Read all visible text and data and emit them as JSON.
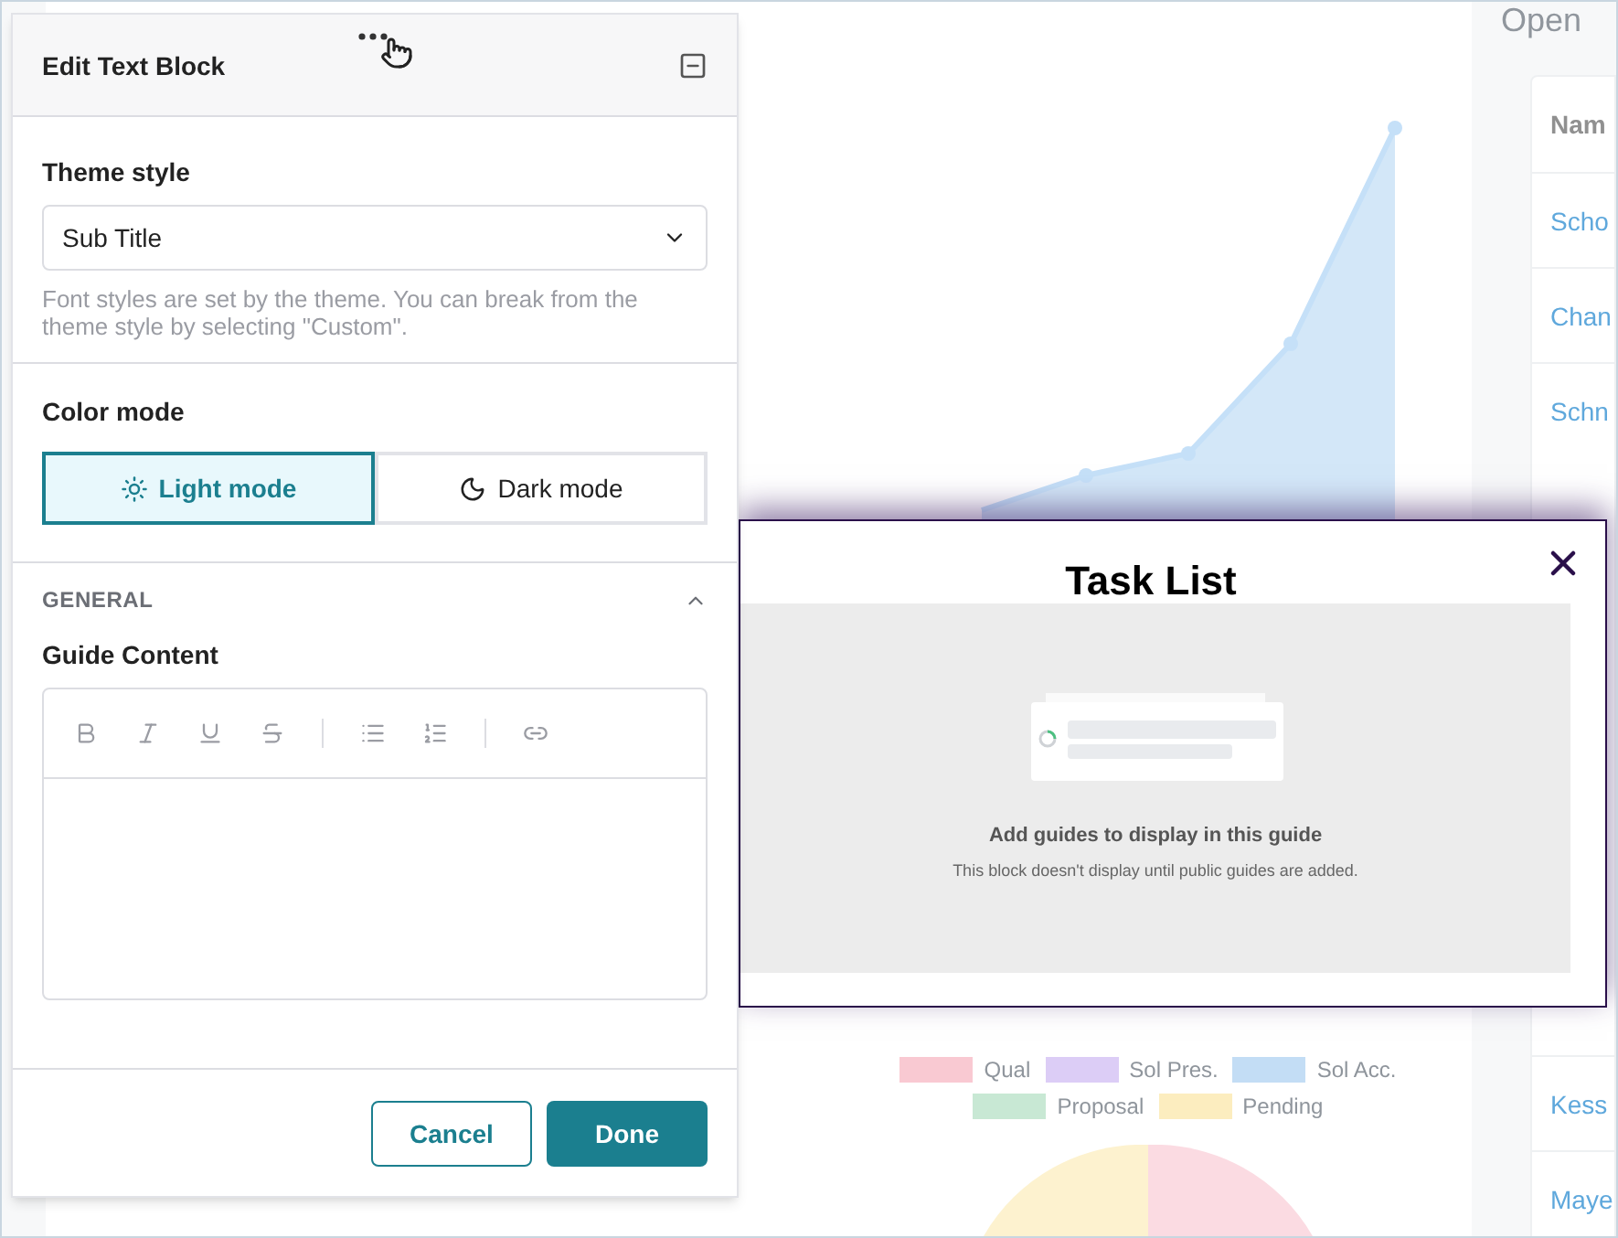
{
  "background": {
    "chart_card": {
      "legend": [
        {
          "label": "Qual",
          "color": "#f9c9d2"
        },
        {
          "label": "Sol Pres.",
          "color": "#dccdf6"
        },
        {
          "label": "Sol Acc.",
          "color": "#c3ddf5"
        },
        {
          "label": "Proposal",
          "color": "#c8e8d4"
        },
        {
          "label": "Pending",
          "color": "#fcedbf"
        }
      ]
    },
    "open_card": {
      "title": "Open",
      "header": "Nam",
      "rows": [
        "Scho",
        "Chan",
        "Schn",
        "Kess",
        "Maye"
      ]
    }
  },
  "edit_panel": {
    "title": "Edit Text Block",
    "theme_style": {
      "label": "Theme style",
      "value": "Sub Title",
      "help": "Font styles are set by the theme. You can break from the theme style by selecting \"Custom\"."
    },
    "color_mode": {
      "label": "Color mode",
      "options": [
        {
          "kind": "light",
          "label": "Light mode",
          "selected": true
        },
        {
          "kind": "dark",
          "label": "Dark mode",
          "selected": false
        }
      ]
    },
    "section": {
      "title": "GENERAL",
      "expanded": true,
      "field_label": "Guide Content"
    },
    "buttons": {
      "cancel": "Cancel",
      "done": "Done"
    }
  },
  "task_list": {
    "title": "Task List",
    "empty_title": "Add guides to display in this guide",
    "empty_text": "This block doesn't display until public guides are added."
  }
}
